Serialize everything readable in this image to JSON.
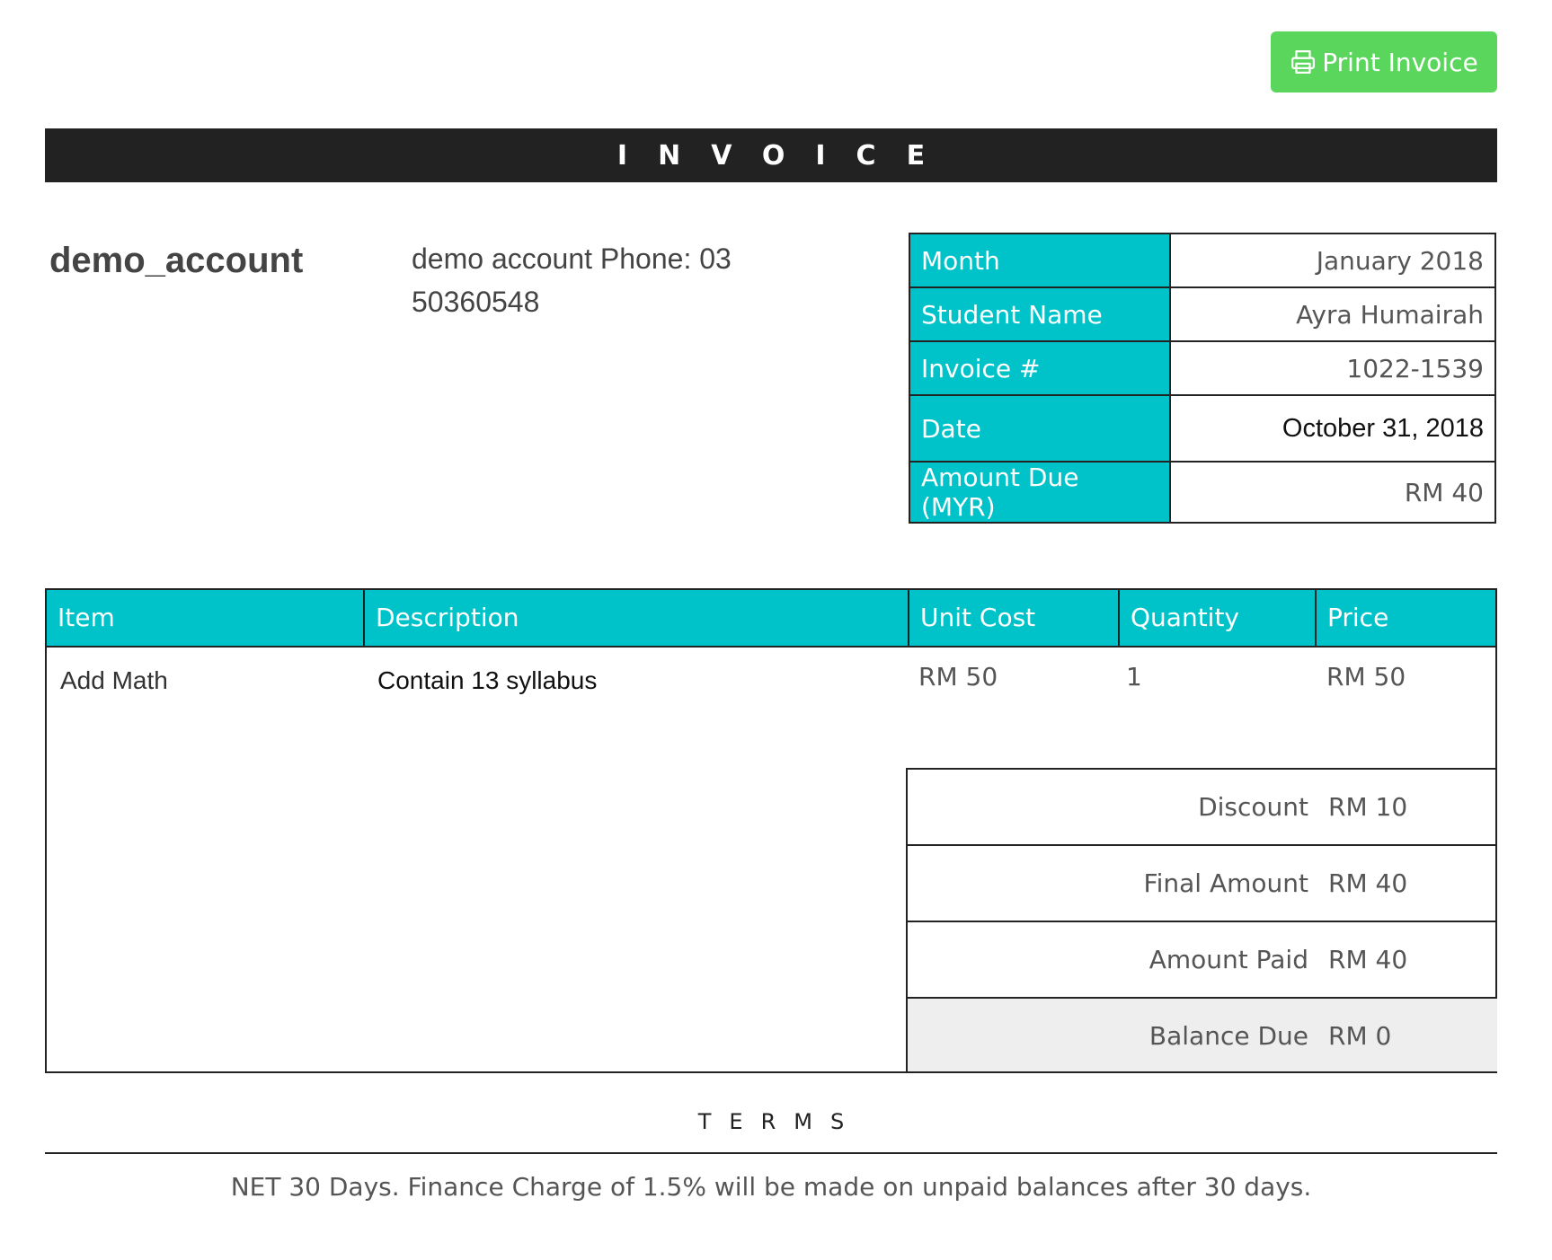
{
  "toolbar": {
    "print_label": "Print Invoice",
    "print_icon": "printer-icon"
  },
  "header": {
    "title": "INVOICE"
  },
  "company": {
    "name": "demo_account",
    "info": "demo account Phone: 03 50360548"
  },
  "meta": [
    {
      "label": "Month",
      "value": "January 2018"
    },
    {
      "label": "Student Name",
      "value": "Ayra Humairah"
    },
    {
      "label": "Invoice #",
      "value": "1022-1539"
    },
    {
      "label": "Date",
      "value": "October 31, 2018"
    },
    {
      "label": "Amount Due (MYR)",
      "value": "RM 40"
    }
  ],
  "items": {
    "headers": [
      "Item",
      "Description",
      "Unit Cost",
      "Quantity",
      "Price"
    ],
    "rows": [
      {
        "item": "Add Math",
        "description": "Contain 13 syllabus",
        "unit_cost": "RM 50",
        "quantity": "1",
        "price": "RM 50"
      }
    ]
  },
  "totals": [
    {
      "label": "Discount",
      "value": "RM 10"
    },
    {
      "label": "Final Amount",
      "value": "RM 40"
    },
    {
      "label": "Amount Paid",
      "value": "RM 40"
    },
    {
      "label": "Balance Due",
      "value": "RM 0"
    }
  ],
  "terms": {
    "title": "TERMS",
    "text": "NET 30 Days. Finance Charge of 1.5% will be made on unpaid balances after 30 days."
  },
  "colors": {
    "accent": "#00c2c9",
    "button": "#5bd65d",
    "title_bar": "#222222",
    "balance_row": "#eeeeee"
  }
}
